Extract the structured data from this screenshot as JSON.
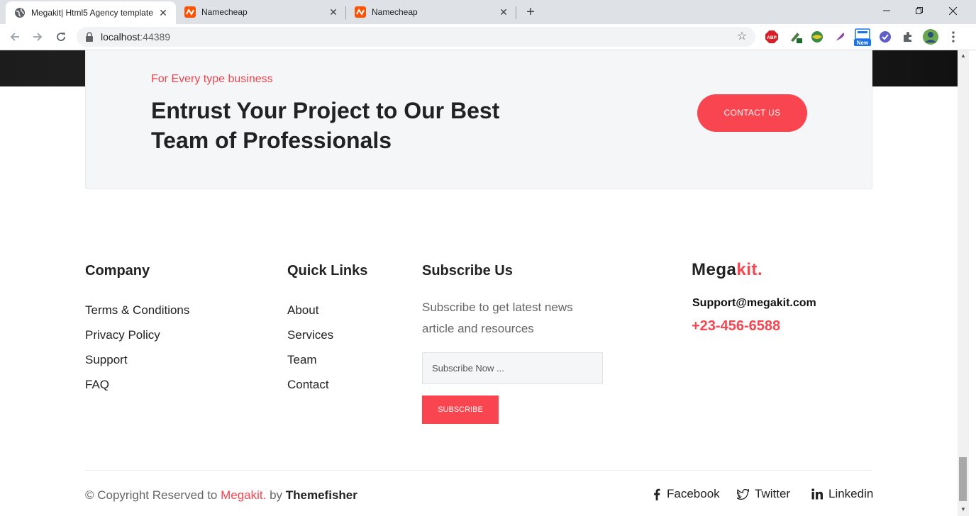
{
  "browser": {
    "tabs": [
      {
        "title": "Megakit| Html5 Agency template",
        "active": true,
        "icon": "globe-icon"
      },
      {
        "title": "Namecheap",
        "active": false,
        "icon": "namecheap-icon"
      },
      {
        "title": "Namecheap",
        "active": false,
        "icon": "namecheap-icon"
      }
    ],
    "url_host": "localhost",
    "url_port": ":44389",
    "extensions": [
      "adblock-icon",
      "pen-tool-icon",
      "globe-ext-icon",
      "feather-icon",
      "new-badge-icon",
      "check-circle-icon",
      "puzzle-icon",
      "profile-avatar",
      "menu-dots-icon"
    ],
    "new_badge": "New",
    "abp_label": "ABP"
  },
  "cta": {
    "subtitle": "For Every type business",
    "title": "Entrust Your Project to Our Best Team of Professionals",
    "button": "CONTACT US"
  },
  "footer": {
    "company": {
      "heading": "Company",
      "links": [
        "Terms & Conditions",
        "Privacy Policy",
        "Support",
        "FAQ"
      ]
    },
    "quick_links": {
      "heading": "Quick Links",
      "links": [
        "About",
        "Services",
        "Team",
        "Contact"
      ]
    },
    "subscribe": {
      "heading": "Subscribe Us",
      "text": "Subscribe to get latest news article and resources",
      "placeholder": "Subscribe Now ...",
      "button": "SUBSCRIBE"
    },
    "brand": {
      "name": "Mega",
      "accent": "kit.",
      "email": "Support@megakit.com",
      "phone": "+23-456-6588"
    },
    "copyright": {
      "prefix": "© Copyright Reserved to ",
      "brand": "Megakit.",
      "middle": " by ",
      "author": "Themefisher"
    },
    "social": [
      {
        "label": "Facebook",
        "icon": "facebook-icon"
      },
      {
        "label": "Twitter",
        "icon": "twitter-icon"
      },
      {
        "label": "Linkedin",
        "icon": "linkedin-icon"
      }
    ]
  },
  "colors": {
    "accent": "#f84550",
    "cta_bg": "#f4f6f8"
  }
}
